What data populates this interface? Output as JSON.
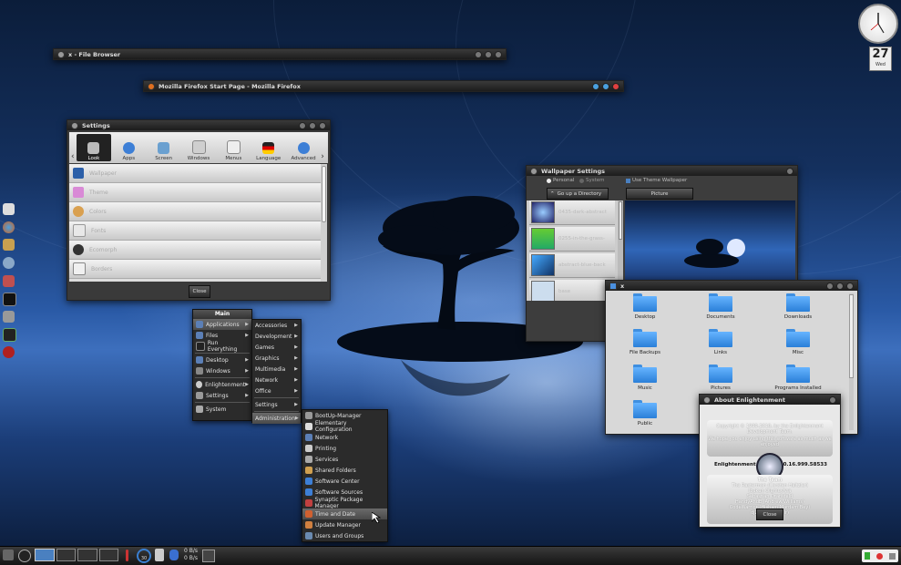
{
  "colors": {
    "accent": "#3f8fe0",
    "menu_bg": "#2b2b2b",
    "titlebar": "#1c1c1c"
  },
  "clock": {
    "date_day": "27",
    "date_weekday": "Wed"
  },
  "windows": {
    "file_browser_title": "x - File Browser",
    "firefox_title": "Mozilla Firefox Start Page - Mozilla Firefox",
    "settings": {
      "title": "Settings",
      "tools": [
        "Look",
        "Apps",
        "Screen",
        "Windows",
        "Menus",
        "Language",
        "Advanced"
      ],
      "items": [
        "Wallpaper",
        "Theme",
        "Colors",
        "Fonts",
        "Ecomorph",
        "Borders"
      ],
      "close_label": "Close"
    },
    "wallpaper_settings": {
      "title": "Wallpaper Settings",
      "radio_personal": "Personal",
      "radio_system": "System",
      "go_up": "Go up a Directory",
      "use_theme": "Use Theme Wallpaper",
      "picture": "Picture",
      "files": [
        "0435-dark-abstract",
        "0255-in-the-grass-",
        "abstract-blue-back",
        "base"
      ]
    },
    "file_manager": {
      "title": "x",
      "folders": [
        "Desktop",
        "Documents",
        "Downloads",
        "File Backups",
        "Links",
        "Misc",
        "Music",
        "Pictures",
        "Programs Installed",
        "Public"
      ]
    },
    "about": {
      "title": "About Enlightenment",
      "copyright": "Copyright © 1999-2010, by the Enlightenment Development Team.",
      "hope": "We hope you enjoy using this software as much as we enjoyed",
      "version_label": "Enlightenment",
      "version": "0.16.999.58533",
      "team_heading": "The Team",
      "team": [
        "The Rasterman (Carsten Haitzler)",
        "Ibukun Olumuyiwa",
        "Sebastian Dransfeld",
        "HandyAndE (Andrew Williams)",
        "CodeWarrior (Hisham Mardam Bey)",
        "dj2 (dan sinclair)"
      ],
      "close_label": "Close"
    }
  },
  "menus": {
    "main": {
      "header": "Main",
      "items": [
        "Applications",
        "Files",
        "Run Everything",
        "Desktop",
        "Windows",
        "Enlightenment",
        "Settings",
        "System"
      ]
    },
    "applications": [
      "Accessories",
      "Development",
      "Games",
      "Graphics",
      "Multimedia",
      "Network",
      "Office",
      "Settings",
      "Administration"
    ],
    "administration": [
      "BootUp-Manager",
      "Elementary Configuration",
      "Network",
      "Printing",
      "Services",
      "Shared Folders",
      "Software Center",
      "Software Sources",
      "Synaptic Package Manager",
      "Time and Date",
      "Update Manager",
      "Users and Groups"
    ]
  },
  "taskbar": {
    "net_down": "0 B/s",
    "net_up": "0 B/s",
    "cpu_label": "30"
  }
}
